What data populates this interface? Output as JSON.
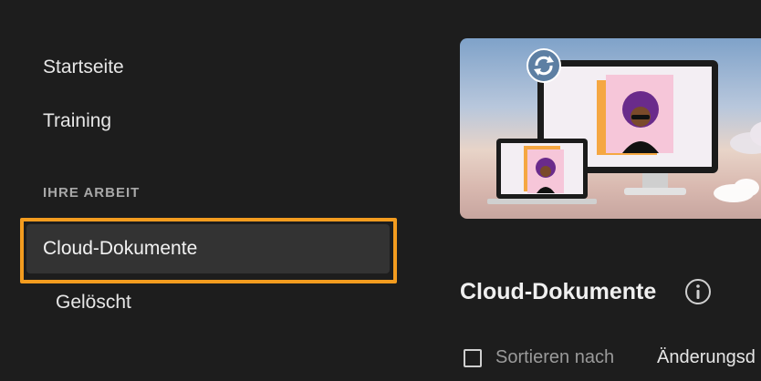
{
  "sidebar": {
    "items": [
      {
        "label": "Startseite"
      },
      {
        "label": "Training"
      }
    ],
    "section_heading": "IHRE ARBEIT",
    "selected_item": {
      "label": "Cloud-Dokumente"
    },
    "sub_items": [
      {
        "label": "Gelöscht"
      }
    ]
  },
  "main": {
    "banner": {
      "icon": "sync-icon"
    },
    "title": "Cloud-Dokumente",
    "info_icon": "info-icon",
    "sort": {
      "label": "Sortieren nach",
      "value": "Änderungsd"
    }
  },
  "colors": {
    "background": "#1d1d1d",
    "selected_item_background": "#333333",
    "highlight_border": "#f39c1f"
  }
}
